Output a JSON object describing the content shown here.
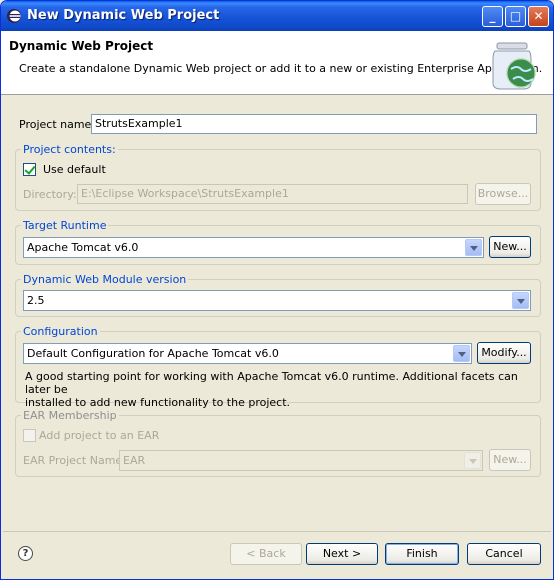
{
  "window": {
    "title": "New Dynamic Web Project",
    "controls": {
      "minimize": "_",
      "maximize": "□",
      "close": "✕"
    }
  },
  "header": {
    "title": "Dynamic Web Project",
    "description": "Create a standalone Dynamic Web project or add it to a new or existing Enterprise Application."
  },
  "project_name": {
    "label": "Project name:",
    "value": "StrutsExample1"
  },
  "project_contents": {
    "title": "Project contents:",
    "use_default": {
      "label": "Use default",
      "checked": true
    },
    "directory": {
      "label": "Directory:",
      "value": "E:\\Eclipse Workspace\\StrutsExample1"
    },
    "browse_label": "Browse..."
  },
  "target_runtime": {
    "title": "Target Runtime",
    "selected": "Apache Tomcat v6.0",
    "new_label": "New..."
  },
  "web_module": {
    "title": "Dynamic Web Module version",
    "selected": "2.5"
  },
  "configuration": {
    "title": "Configuration",
    "selected": "Default Configuration for Apache Tomcat v6.0",
    "modify_label": "Modify...",
    "description_line1": "A good starting point for working with Apache Tomcat v6.0 runtime. Additional facets can later be",
    "description_line2": "installed to add new functionality to the project."
  },
  "ear": {
    "title": "EAR Membership",
    "add_label": "Add project to an EAR",
    "project_name_label": "EAR Project Name:",
    "selected": "EAR",
    "new_label": "New..."
  },
  "footer": {
    "help_glyph": "?",
    "back_label": "< Back",
    "next_label": "Next >",
    "finish_label": "Finish",
    "cancel_label": "Cancel"
  },
  "colors": {
    "titlebar": "#0f48c8",
    "group_title": "#0046d5",
    "dialog_bg": "#ece9d8"
  }
}
